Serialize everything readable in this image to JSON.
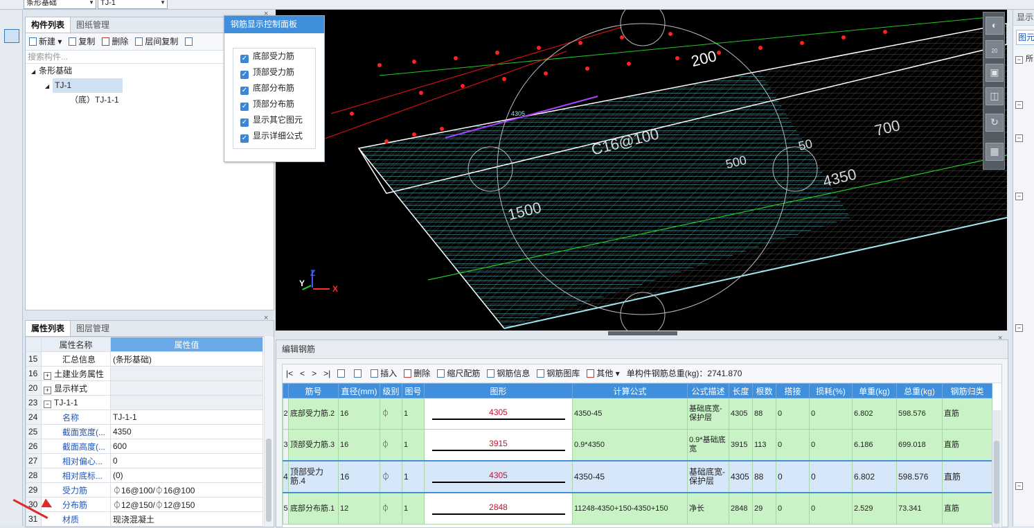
{
  "top": {
    "combo1": "条形基础",
    "combo2": "TJ-1"
  },
  "component_list": {
    "tabs": [
      "构件列表",
      "图纸管理"
    ],
    "toolbar": {
      "new": "新建",
      "copy": "复制",
      "delete": "删除",
      "floor_copy": "层间复制"
    },
    "search_placeholder": "搜索构件...",
    "tree": {
      "root": "条形基础",
      "child": "TJ-1",
      "leaf": "（底）TJ-1-1"
    }
  },
  "properties": {
    "tabs": [
      "属性列表",
      "图层管理"
    ],
    "header": {
      "name": "属性名称",
      "value": "属性值"
    },
    "rows": [
      {
        "n": "15",
        "name": "汇总信息",
        "value": "(条形基础)"
      },
      {
        "n": "16",
        "name": "土建业务属性",
        "value": ""
      },
      {
        "n": "20",
        "name": "显示样式",
        "value": ""
      },
      {
        "n": "23",
        "name": "TJ-1-1",
        "value": ""
      },
      {
        "n": "24",
        "name": "名称",
        "value": "TJ-1-1"
      },
      {
        "n": "25",
        "name": "截面宽度(...",
        "value": "4350"
      },
      {
        "n": "26",
        "name": "截面高度(...",
        "value": "600"
      },
      {
        "n": "27",
        "name": "相对偏心...",
        "value": "0"
      },
      {
        "n": "28",
        "name": "相对底标...",
        "value": "(0)"
      },
      {
        "n": "29",
        "name": "受力筋",
        "value": "⏀16@100/⏀16@100"
      },
      {
        "n": "30",
        "name": "分布筋",
        "value": "⏀12@150/⏀12@150"
      },
      {
        "n": "31",
        "name": "材质",
        "value": "现浇混凝土"
      }
    ]
  },
  "control_panel": {
    "title": "钢筋显示控制面板",
    "options": [
      "底部受力筋",
      "顶部受力筋",
      "底部分布筋",
      "顶部分布筋",
      "显示其它图元",
      "显示详细公式"
    ]
  },
  "viewport": {
    "labels": [
      "4305",
      "C16@100",
      "200",
      "1500",
      "700",
      "4350",
      "500",
      "50"
    ],
    "axes": {
      "x": "X",
      "y": "Y",
      "z": "Z"
    },
    "nav_badge": "20"
  },
  "edit": {
    "title": "编辑钢筋",
    "toolbar": {
      "insert": "插入",
      "delete": "删除",
      "scale": "缩尺配筋",
      "info": "钢筋信息",
      "lib": "钢筋图库",
      "other": "其他",
      "total": "单构件钢筋总重(kg)：2741.870"
    },
    "headers": [
      "筋号",
      "直径(mm)",
      "级别",
      "图号",
      "图形",
      "计算公式",
      "公式描述",
      "长度",
      "根数",
      "搭接",
      "损耗(%)",
      "单重(kg)",
      "总重(kg)",
      "钢筋归类"
    ],
    "rows": [
      {
        "rn": "2",
        "name": "底部受力筋.2",
        "dia": "16",
        "grade": "⏀",
        "fig": "1",
        "shape": "4305",
        "formula": "4350-45",
        "desc": "基础底宽-保护层",
        "len": "4305",
        "count": "88",
        "lap": "0",
        "loss": "0",
        "unit": "6.802",
        "total": "598.576",
        "cls": "直筋"
      },
      {
        "rn": "3",
        "name": "顶部受力筋.3",
        "dia": "16",
        "grade": "⏀",
        "fig": "1",
        "shape": "3915",
        "formula": "0.9*4350",
        "desc": "0.9*基础底宽",
        "len": "3915",
        "count": "113",
        "lap": "0",
        "loss": "0",
        "unit": "6.186",
        "total": "699.018",
        "cls": "直筋"
      },
      {
        "rn": "4",
        "name": "顶部受力筋.4",
        "dia": "16",
        "grade": "⏀",
        "fig": "1",
        "shape": "4305",
        "formula": "4350-45",
        "desc": "基础底宽-保护层",
        "len": "4305",
        "count": "88",
        "lap": "0",
        "loss": "0",
        "unit": "6.802",
        "total": "598.576",
        "cls": "直筋"
      },
      {
        "rn": "5",
        "name": "底部分布筋.1",
        "dia": "12",
        "grade": "⏀",
        "fig": "1",
        "shape": "2848",
        "formula": "11248-4350+150-4350+150",
        "desc": "净长",
        "len": "2848",
        "count": "29",
        "lap": "0",
        "loss": "0",
        "unit": "2.529",
        "total": "73.341",
        "cls": "直筋"
      }
    ]
  },
  "right_panel": {
    "tab": "显示",
    "sub": "图元",
    "item": "所"
  }
}
